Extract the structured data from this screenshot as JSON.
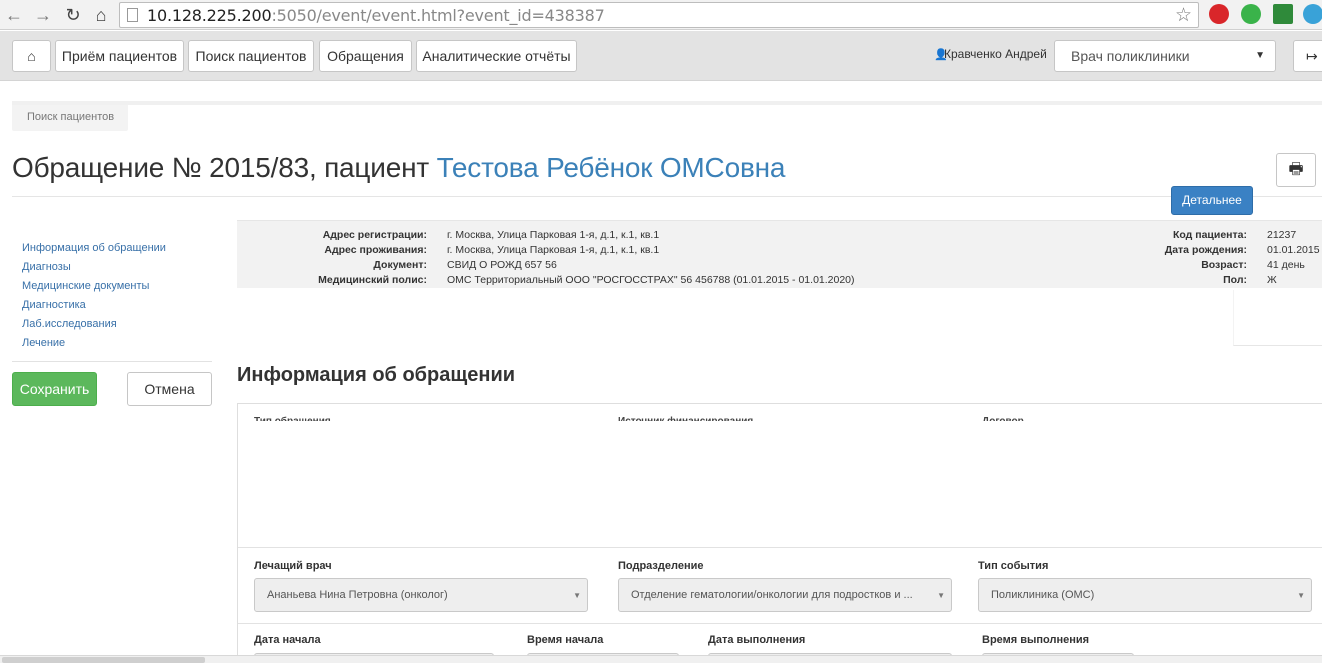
{
  "browser": {
    "url_host": "10.128.225.200",
    "url_rest": ":5050/event/event.html?event_id=438387",
    "colors": {
      "ext_red": "#d9262a",
      "ext_green": "#3ab34a",
      "ext_blue": "#39a2d8"
    }
  },
  "navbar": {
    "home_icon": "⌂",
    "items": [
      "Приём пациентов",
      "Поиск пациентов",
      "Обращения",
      "Аналитические отчёты"
    ],
    "user_name": "Кравченко Андрей",
    "role": "Врач поликлиники",
    "logout_icon": "↦"
  },
  "breadcrumb": "Поиск пациентов",
  "page": {
    "title_prefix": "Обращение № 2015/83, пациент",
    "patient_name": "Тестова Ребёнок ОМСовна",
    "detail_button": "Детальнее",
    "print_icon": "🖶"
  },
  "sidebar": {
    "links": [
      "Информация об обращении",
      "Диагнозы",
      "Медицинские документы",
      "Диагностика",
      "Лаб.исследования",
      "Лечение"
    ],
    "save": "Сохранить",
    "cancel": "Отмена"
  },
  "patient_info": {
    "left": [
      {
        "label": "Адрес регистрации:",
        "value": "г. Москва, Улица Парковая 1-я, д.1, к.1, кв.1"
      },
      {
        "label": "Адрес проживания:",
        "value": "г. Москва, Улица Парковая 1-я, д.1, к.1, кв.1"
      },
      {
        "label": "Документ:",
        "value": "СВИД О РОЖД 657 56"
      },
      {
        "label": "Медицинский полис:",
        "value": "ОМС Территориальный ООО \"РОСГОССТРАХ\" 56 456788 (01.01.2015 - 01.01.2020)"
      }
    ],
    "right": [
      {
        "label": "Код пациента:",
        "value": "21237"
      },
      {
        "label": "Дата рождения:",
        "value": "01.01.2015"
      },
      {
        "label": "Возраст:",
        "value": "41 день"
      },
      {
        "label": "Пол:",
        "value": "Ж"
      }
    ]
  },
  "form": {
    "section_title": "Информация об обращении",
    "faded_labels": [
      "Тип обращения",
      "Источник финансирования",
      "Договор"
    ],
    "fields": [
      {
        "label": "Лечащий врач",
        "value": "Ананьева Нина Петровна (онколог)"
      },
      {
        "label": "Подразделение",
        "value": "Отделение гематологии/онкологии для подростков и ..."
      },
      {
        "label": "Тип события",
        "value": "Поликлиника (ОМС)"
      }
    ],
    "bottom_labels": [
      "Дата начала",
      "Время начала",
      "Дата выполнения",
      "Время выполнения"
    ]
  }
}
